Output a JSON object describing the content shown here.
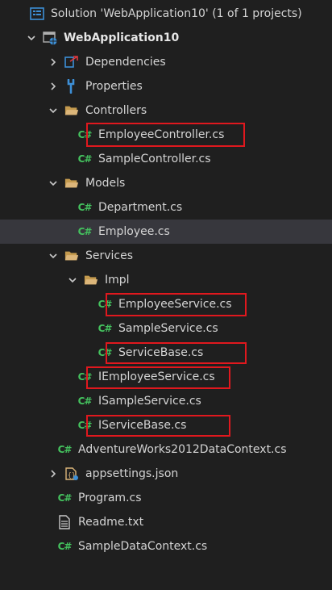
{
  "solution": {
    "title": "Solution 'WebApplication10' (1 of 1 projects)"
  },
  "project": {
    "name": "WebApplication10"
  },
  "nodes": {
    "dependencies": "Dependencies",
    "properties": "Properties",
    "controllers": "Controllers",
    "employee_controller": "EmployeeController.cs",
    "sample_controller": "SampleController.cs",
    "models": "Models",
    "department": "Department.cs",
    "employee": "Employee.cs",
    "services": "Services",
    "impl": "Impl",
    "employee_service": "EmployeeService.cs",
    "sample_service": "SampleService.cs",
    "service_base": "ServiceBase.cs",
    "iemployee_service": "IEmployeeService.cs",
    "isample_service": "ISampleService.cs",
    "iservice_base": "IServiceBase.cs",
    "adventureworks_context": "AdventureWorks2012DataContext.cs",
    "appsettings": "appsettings.json",
    "program": "Program.cs",
    "readme": "Readme.txt",
    "sample_data_context": "SampleDataContext.cs"
  },
  "colors": {
    "background": "#1f1f1f",
    "selected_row": "#37373d",
    "highlight_box": "#e0181e",
    "csharp_icon": "#44c25e",
    "folder_icon": "#dcb67a"
  },
  "icons": {
    "cs": "C#",
    "solution": "solution-icon",
    "project": "web-project-icon",
    "folder": "folder-icon",
    "dependencies": "dependencies-icon",
    "properties": "wrench-icon",
    "json": "json-settings-icon",
    "text": "text-file-icon"
  }
}
